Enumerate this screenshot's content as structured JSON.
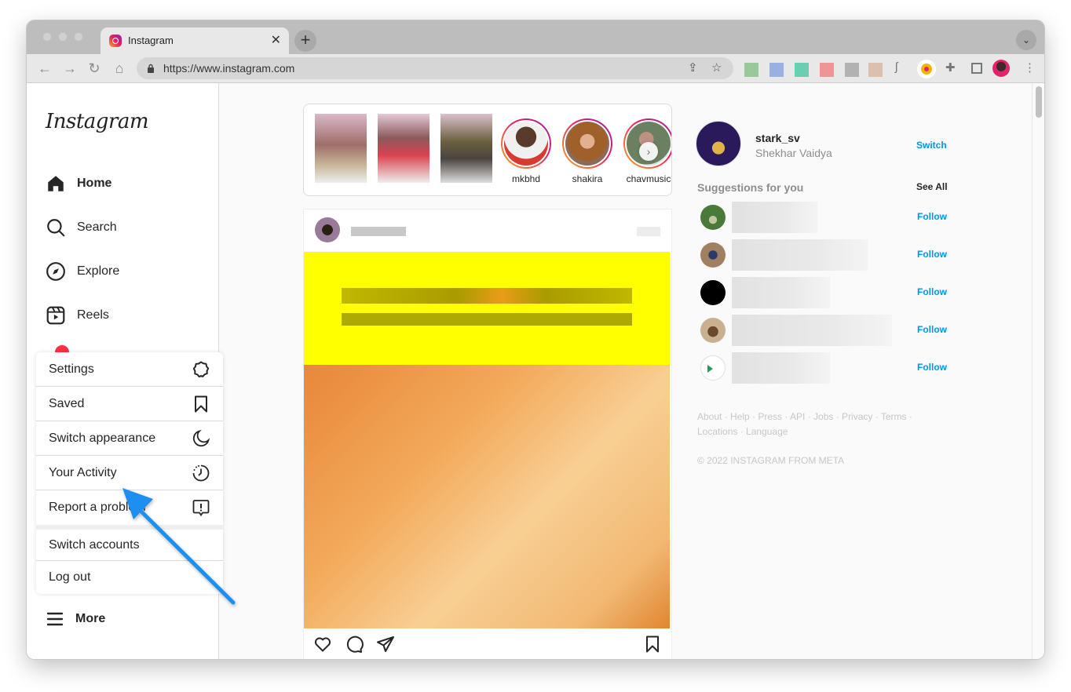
{
  "browser": {
    "tab_title": "Instagram",
    "url": "https://www.instagram.com",
    "close_glyph": "✕",
    "newtab_glyph": "+",
    "tabsearch_glyph": "⌄"
  },
  "sidebar": {
    "logo": "Instagram",
    "nav": [
      {
        "label": "Home",
        "icon": "home-icon"
      },
      {
        "label": "Search",
        "icon": "search-icon"
      },
      {
        "label": "Explore",
        "icon": "compass-icon"
      },
      {
        "label": "Reels",
        "icon": "reels-icon"
      }
    ],
    "more_label": "More"
  },
  "menu": {
    "items": [
      {
        "label": "Settings",
        "icon": "settings-icon"
      },
      {
        "label": "Saved",
        "icon": "bookmark-icon"
      },
      {
        "label": "Switch appearance",
        "icon": "moon-icon"
      },
      {
        "label": "Your Activity",
        "icon": "activity-icon"
      },
      {
        "label": "Report a problem",
        "icon": "report-icon"
      }
    ],
    "switch_accounts": "Switch accounts",
    "log_out": "Log out"
  },
  "stories": {
    "named": [
      "mkbhd",
      "shakira",
      "chavmusic"
    ],
    "next_glyph": "›"
  },
  "profile": {
    "username": "stark_sv",
    "full_name": "Shekhar Vaidya",
    "switch_label": "Switch"
  },
  "suggestions": {
    "title": "Suggestions for you",
    "see_all": "See All",
    "follow_label": "Follow",
    "count": 5
  },
  "footer": {
    "links": "About · Help · Press · API · Jobs · Privacy · Terms · Locations · Language",
    "copyright": "© 2022 INSTAGRAM FROM META"
  },
  "annotation": {
    "arrow_color": "#1e8ff0"
  }
}
